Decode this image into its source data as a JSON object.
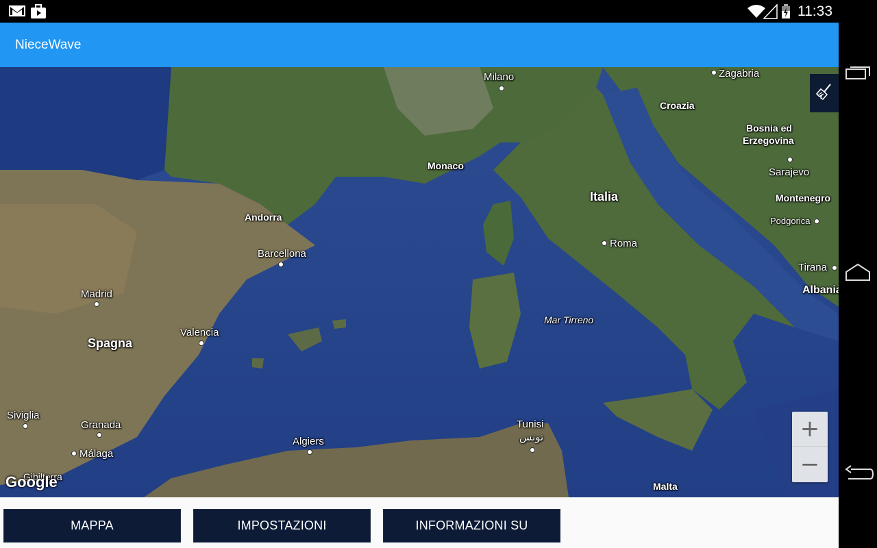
{
  "status_bar": {
    "time": "11:33",
    "icons": [
      "gmail-icon",
      "briefcase-icon",
      "wifi-icon",
      "signal-icon",
      "battery-icon"
    ]
  },
  "app": {
    "title": "NieceWave",
    "accent": "#2196f3"
  },
  "map": {
    "places": {
      "milano": "Milano",
      "zagabria": "Zagabria",
      "croazia": "Croazia",
      "bosnia1": "Bosnia ed",
      "bosnia2": "Erzegovina",
      "sarajevo": "Sarajevo",
      "monaco": "Monaco",
      "italia": "Italia",
      "montenegro": "Montenegro",
      "podgorica": "Podgorica",
      "andorra": "Andorra",
      "roma": "Roma",
      "barcellona": "Barcellona",
      "tirana": "Tirana",
      "albania": "Albania",
      "madrid": "Madrid",
      "mar_tirreno": "Mar Tirreno",
      "valencia": "Valencia",
      "spagna": "Spagna",
      "siviglia": "Siviglia",
      "granada": "Granada",
      "tunisi": "Tunisi",
      "tunisi_ar": "تونس",
      "algiers": "Algiers",
      "malaga": "Málaga",
      "gibilterra": "Gibilterra",
      "malta": "Malta"
    },
    "attribution": "Google",
    "zoom_in": "+",
    "zoom_out": "−"
  },
  "bottom_buttons": {
    "mappa": "MAPPA",
    "impostazioni": "IMPOSTAZIONI",
    "informazioni": "INFORMAZIONI SU"
  },
  "nav_icons": [
    "recent-apps-icon",
    "home-icon",
    "back-icon"
  ]
}
